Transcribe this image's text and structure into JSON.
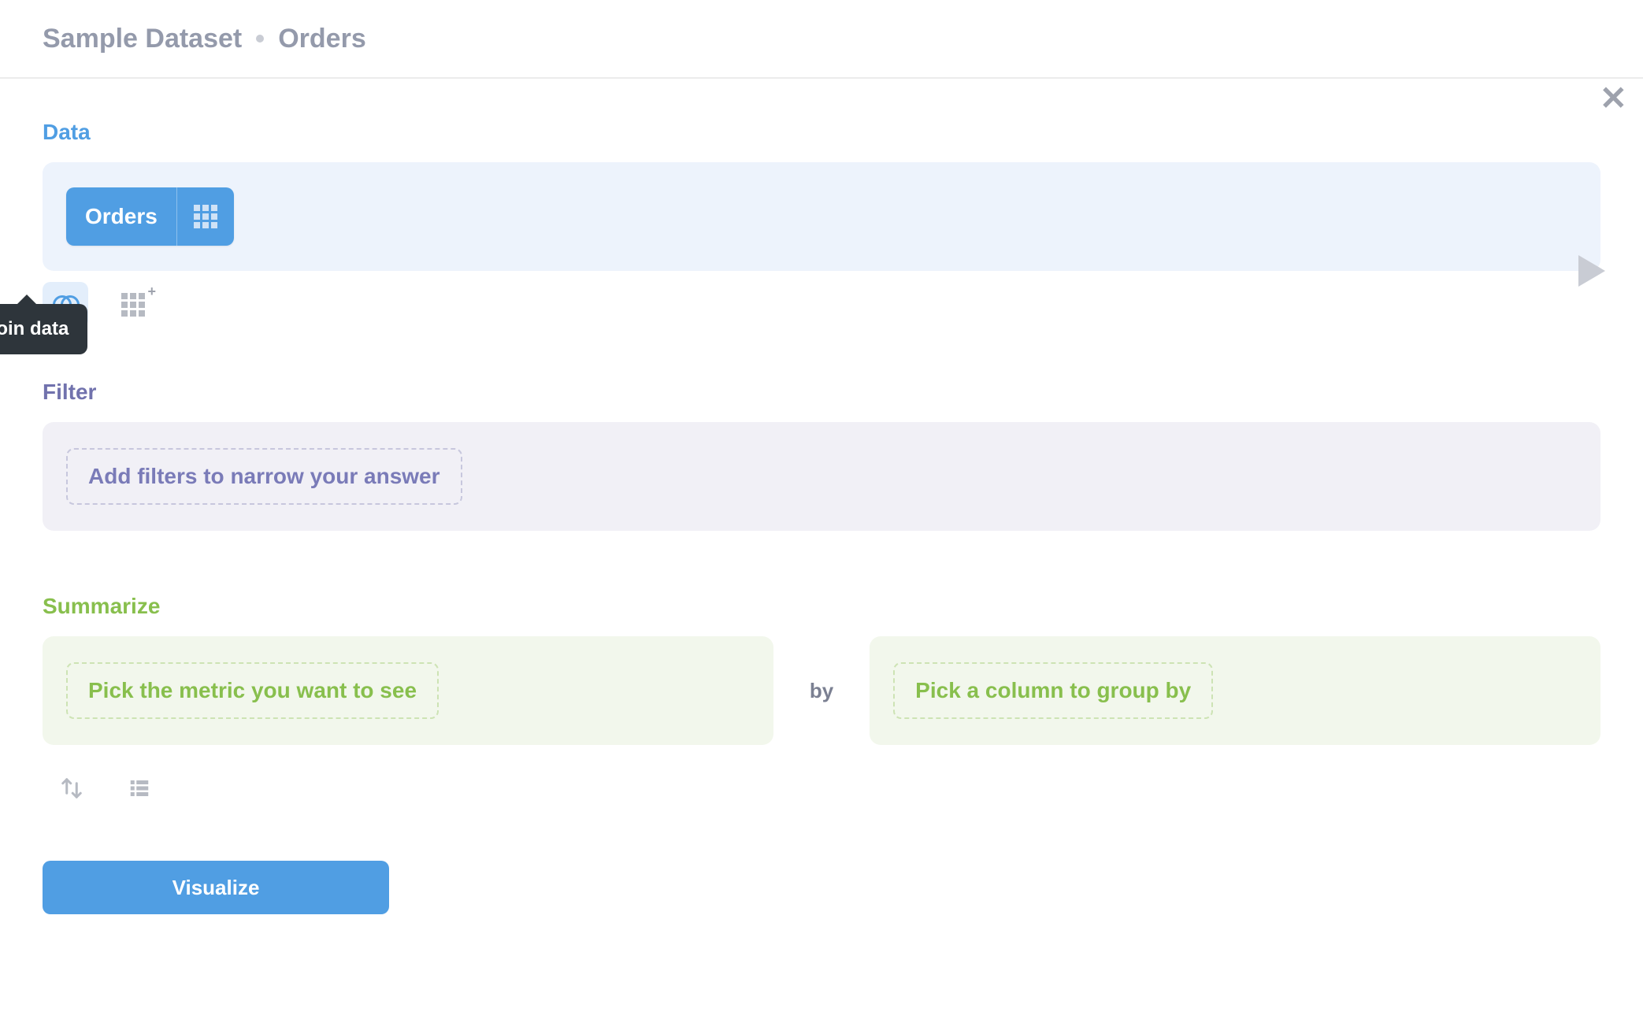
{
  "breadcrumb": {
    "dataset": "Sample Dataset",
    "table": "Orders"
  },
  "sections": {
    "data": {
      "header": "Data",
      "selected_table": "Orders"
    },
    "filter": {
      "header": "Filter",
      "add_label": "Add filters to narrow your answer"
    },
    "summarize": {
      "header": "Summarize",
      "metric_label": "Pick the metric you want to see",
      "by_label": "by",
      "group_label": "Pick a column to group by"
    }
  },
  "tooltip": {
    "join_data": "Join data"
  },
  "actions": {
    "visualize": "Visualize"
  },
  "colors": {
    "blue": "#509ee3",
    "purple": "#7172ad",
    "green": "#88bf4d",
    "text_muted": "#949aab",
    "tooltip_bg": "#2e353b"
  }
}
